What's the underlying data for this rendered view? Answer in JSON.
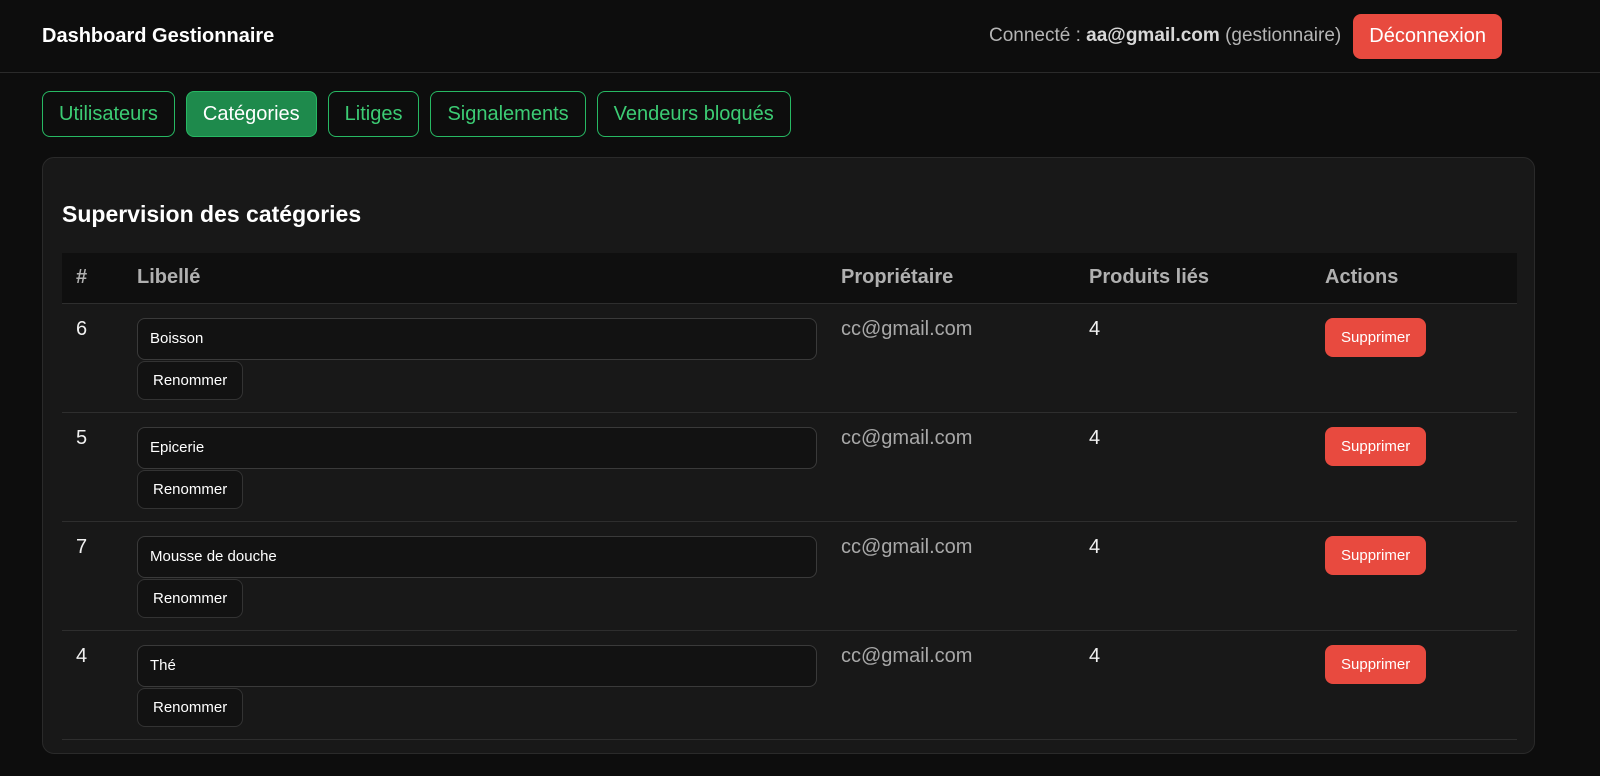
{
  "header": {
    "title": "Dashboard Gestionnaire",
    "connected_prefix": "Connecté : ",
    "user_email": "aa@gmail.com",
    "user_role": " (gestionnaire)",
    "logout_label": "Déconnexion"
  },
  "tabs": [
    {
      "label": "Utilisateurs",
      "active": false
    },
    {
      "label": "Catégories",
      "active": true
    },
    {
      "label": "Litiges",
      "active": false
    },
    {
      "label": "Signalements",
      "active": false
    },
    {
      "label": "Vendeurs bloqués",
      "active": false
    }
  ],
  "panel": {
    "title": "Supervision des catégories",
    "columns": [
      "#",
      "Libellé",
      "Propriétaire",
      "Produits liés",
      "Actions"
    ],
    "rows": [
      {
        "id": "6",
        "label": "Boisson",
        "owner": "cc@gmail.com",
        "products": "4",
        "rename": "Renommer",
        "delete": "Supprimer"
      },
      {
        "id": "5",
        "label": "Epicerie",
        "owner": "cc@gmail.com",
        "products": "4",
        "rename": "Renommer",
        "delete": "Supprimer"
      },
      {
        "id": "7",
        "label": "Mousse de douche",
        "owner": "cc@gmail.com",
        "products": "4",
        "rename": "Renommer",
        "delete": "Supprimer"
      },
      {
        "id": "4",
        "label": "Thé",
        "owner": "cc@gmail.com",
        "products": "4",
        "rename": "Renommer",
        "delete": "Supprimer"
      }
    ]
  },
  "colors": {
    "accent_green": "#27b863",
    "active_tab_bg": "#1e8a4c",
    "danger": "#e84a3f",
    "background": "#0d0d0d",
    "panel": "#181818"
  }
}
